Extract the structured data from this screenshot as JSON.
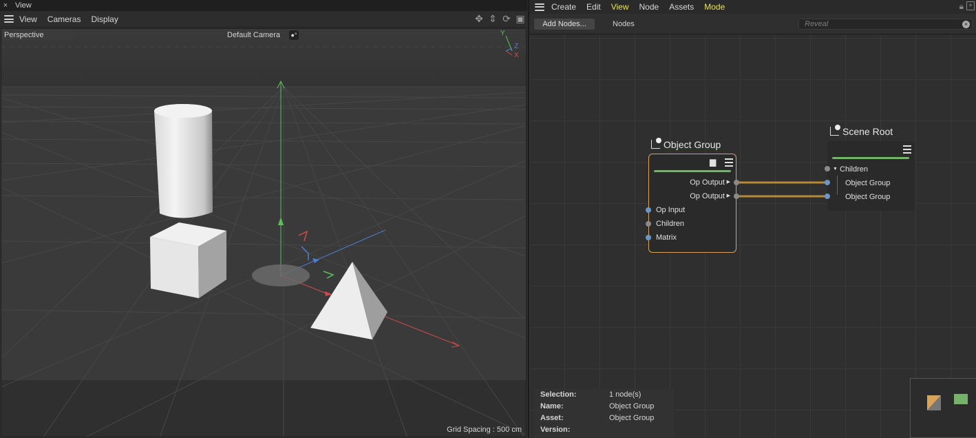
{
  "left_panel": {
    "title": "View",
    "close_glyph": "×",
    "menu": [
      "View",
      "Cameras",
      "Display"
    ],
    "viewport_label": "Perspective",
    "camera_label": "Default Camera",
    "grid_spacing": "Grid Spacing : 500 cm",
    "axis_gizmo": {
      "y": "Y",
      "z": "Z",
      "x": "X"
    },
    "toolbar_icons": [
      "move-view-icon",
      "vertical-move-icon",
      "rotate-view-icon",
      "toggle-layout-icon"
    ]
  },
  "right_panel": {
    "menu": [
      {
        "label": "Create",
        "active": false
      },
      {
        "label": "Edit",
        "active": false
      },
      {
        "label": "View",
        "active": true
      },
      {
        "label": "Node",
        "active": false
      },
      {
        "label": "Assets",
        "active": false
      },
      {
        "label": "Mode",
        "active": true
      }
    ],
    "add_nodes_label": "Add Nodes...",
    "nodes_tab_label": "Nodes",
    "search_placeholder": "Reveal",
    "nodes": {
      "object_group": {
        "title": "Object Group",
        "outputs": [
          "Op Output",
          "Op Output"
        ],
        "inputs": [
          "Op Input",
          "Children",
          "Matrix"
        ]
      },
      "scene_root": {
        "title": "Scene Root",
        "group_label": "Children",
        "inputs": [
          "Object Group",
          "Object Group"
        ]
      }
    },
    "info": {
      "selection_key": "Selection:",
      "selection_val": "1 node(s)",
      "name_key": "Name:",
      "name_val": "Object Group",
      "asset_key": "Asset:",
      "asset_val": "Object Group",
      "version_key": "Version:",
      "version_val": ""
    }
  },
  "colors": {
    "accent_yellow": "#e8e35b",
    "wire": "#b58a3a",
    "node_green_bar": "#76b36a",
    "selected_outline": "#d9a45a",
    "port_blue": "#6d96c8"
  }
}
